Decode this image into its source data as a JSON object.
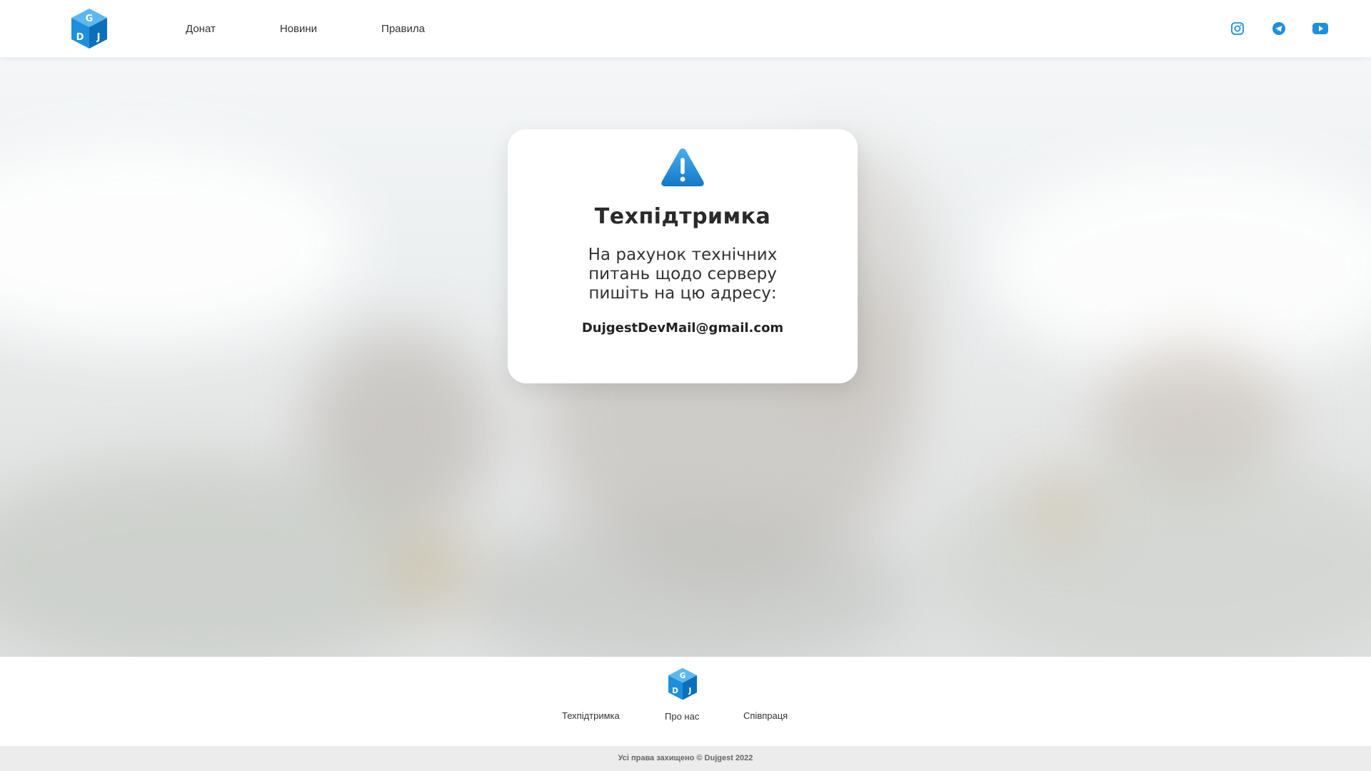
{
  "header": {
    "nav": [
      {
        "label": "Донат"
      },
      {
        "label": "Новини"
      },
      {
        "label": "Правила"
      }
    ],
    "social": [
      "instagram-icon",
      "telegram-icon",
      "youtube-icon"
    ]
  },
  "logo": {
    "letters": [
      "G",
      "D",
      "J"
    ]
  },
  "card": {
    "icon": "warning-icon",
    "title": "Техпідтримка",
    "message": "На рахунок технічних питань щодо серверу пишіть на цю адресу:",
    "email": "DujgestDevMail@gmail.com"
  },
  "footer": {
    "links": {
      "support": "Техпідтримка",
      "about": "Про нас",
      "partnership": "Співпраця"
    },
    "copyright": "Усі права захищено © Dujgest 2022"
  },
  "colors": {
    "accent": "#1e8fdb",
    "accent_dark": "#0d6fb8"
  }
}
